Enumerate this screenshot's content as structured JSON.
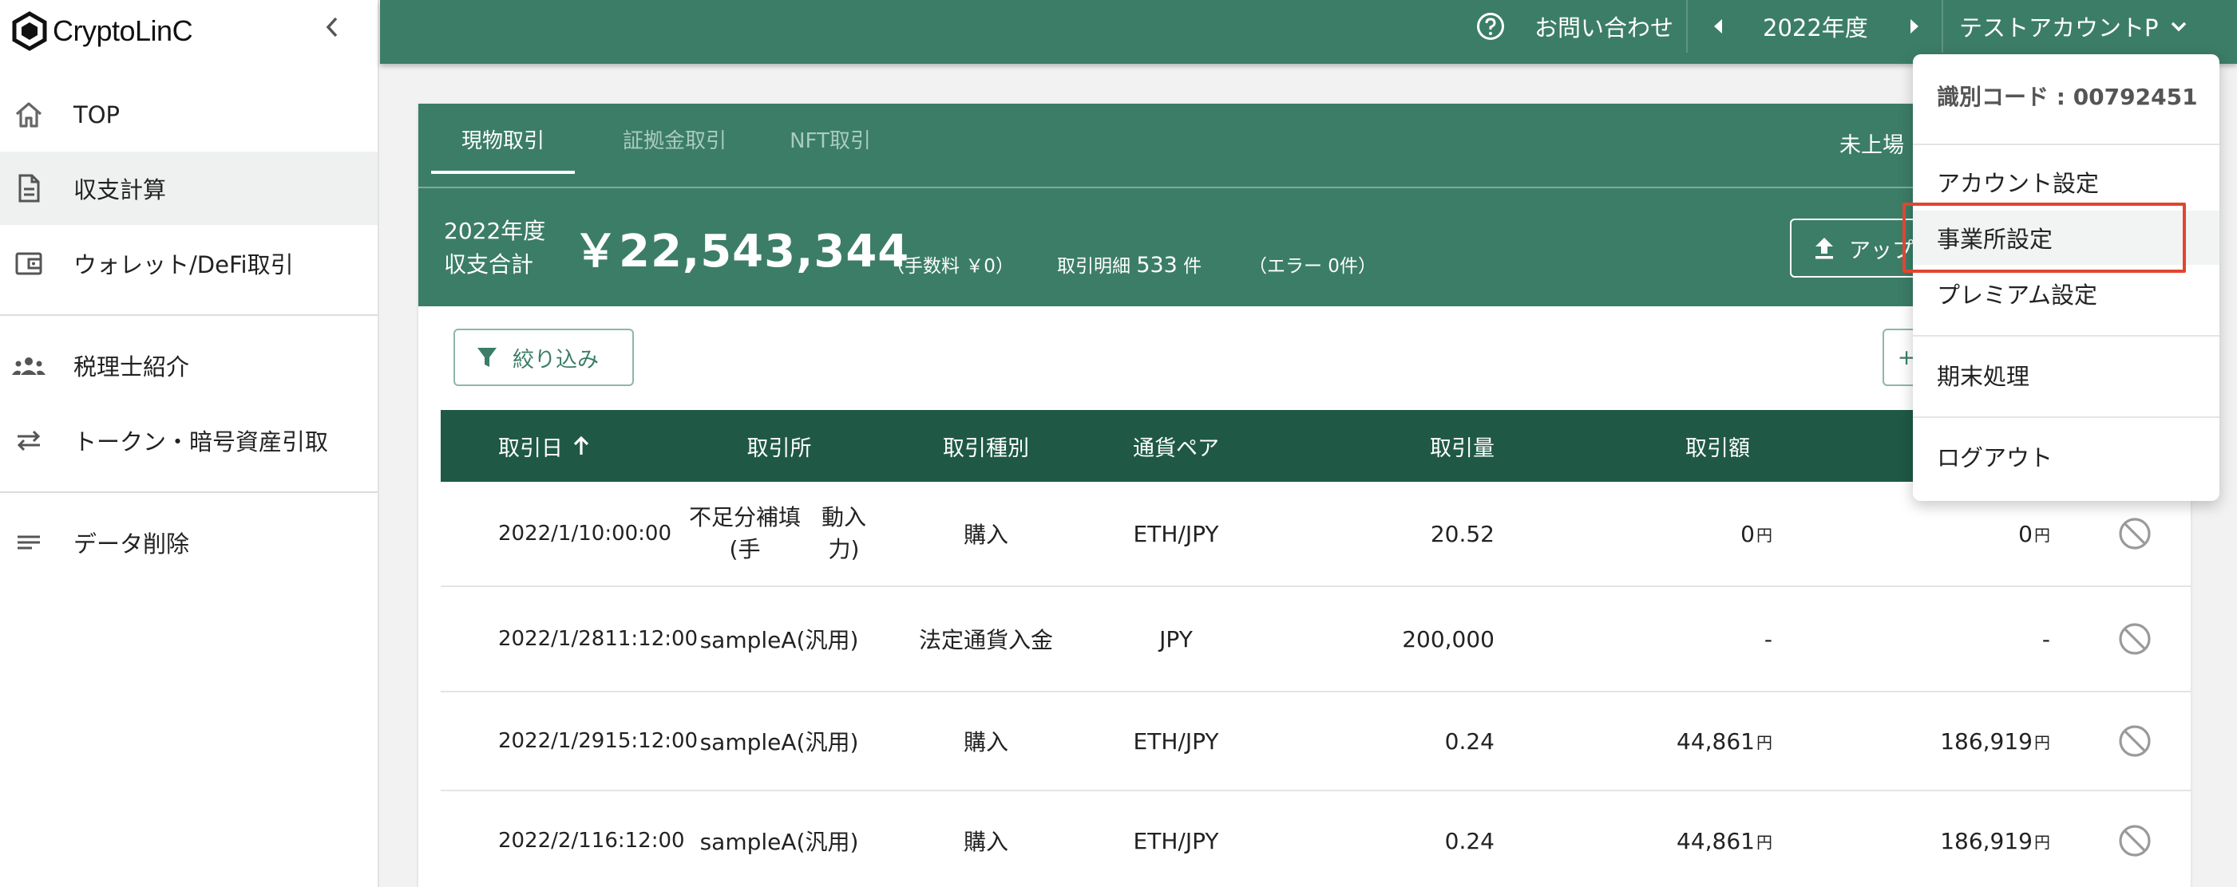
{
  "brand": {
    "name": "CryptoLinC"
  },
  "sidebar": {
    "items": [
      {
        "label": "TOP",
        "icon": "home-icon"
      },
      {
        "label": "収支計算",
        "icon": "document-icon"
      },
      {
        "label": "ウォレット/DeFi取引",
        "icon": "wallet-icon"
      },
      {
        "label": "税理士紹介",
        "icon": "people-icon"
      },
      {
        "label": "トークン・暗号資産引取",
        "icon": "swap-icon"
      },
      {
        "label": "データ削除",
        "icon": "lines-icon"
      }
    ]
  },
  "header": {
    "contact": "お問い合わせ",
    "year": "2022年度",
    "account": "テストアカウントP"
  },
  "tabs": [
    "現物取引",
    "証拠金取引",
    "NFT取引"
  ],
  "summary": {
    "unlisted_label": "未上場",
    "year_line1": "2022年度",
    "year_line2": "収支合計",
    "total": "￥22,543,344",
    "fee_text": "（手数料 ￥0）",
    "detail_label": "取引明細",
    "detail_count": "533",
    "detail_unit": "件",
    "error_text": "（エラー 0件）",
    "upload_label": "アップ"
  },
  "filter_label": "絞り込み",
  "table": {
    "headers": [
      "取引日",
      "取引所",
      "取引種別",
      "通貨ペア",
      "取引量",
      "取引額"
    ],
    "yen_unit": "円",
    "rows": [
      {
        "date1": "2022/1/1",
        "date2": "0:00:00",
        "ex1": "不足分補填(手",
        "ex2": "動入力)",
        "type": "購入",
        "pair": "ETH/JPY",
        "qty": "20.52",
        "amount": "0",
        "value": "0",
        "amount_yen": true,
        "value_yen": true
      },
      {
        "date1": "2022/1/28",
        "date2": "11:12:00",
        "ex1": "sampleA(汎用)",
        "ex2": "",
        "type": "法定通貨入金",
        "pair": "JPY",
        "qty": "200,000",
        "amount": "-",
        "value": "-",
        "amount_yen": false,
        "value_yen": false
      },
      {
        "date1": "2022/1/29",
        "date2": "15:12:00",
        "ex1": "sampleA(汎用)",
        "ex2": "",
        "type": "購入",
        "pair": "ETH/JPY",
        "qty": "0.24",
        "amount": "44,861",
        "value": "186,919",
        "amount_yen": true,
        "value_yen": true
      },
      {
        "date1": "2022/2/1",
        "date2": "16:12:00",
        "ex1": "sampleA(汎用)",
        "ex2": "",
        "type": "購入",
        "pair": "ETH/JPY",
        "qty": "0.24",
        "amount": "44,861",
        "value": "186,919",
        "amount_yen": true,
        "value_yen": true
      }
    ]
  },
  "account_menu": {
    "code_label": "識別コード : 00792451",
    "items": [
      "アカウント設定",
      "事業所設定",
      "プレミアム設定",
      "期末処理",
      "ログアウト"
    ],
    "highlighted": "事業所設定"
  },
  "colors": {
    "primary": "#3c7d68",
    "table_header": "#1f5945",
    "highlight": "#e2452f"
  }
}
